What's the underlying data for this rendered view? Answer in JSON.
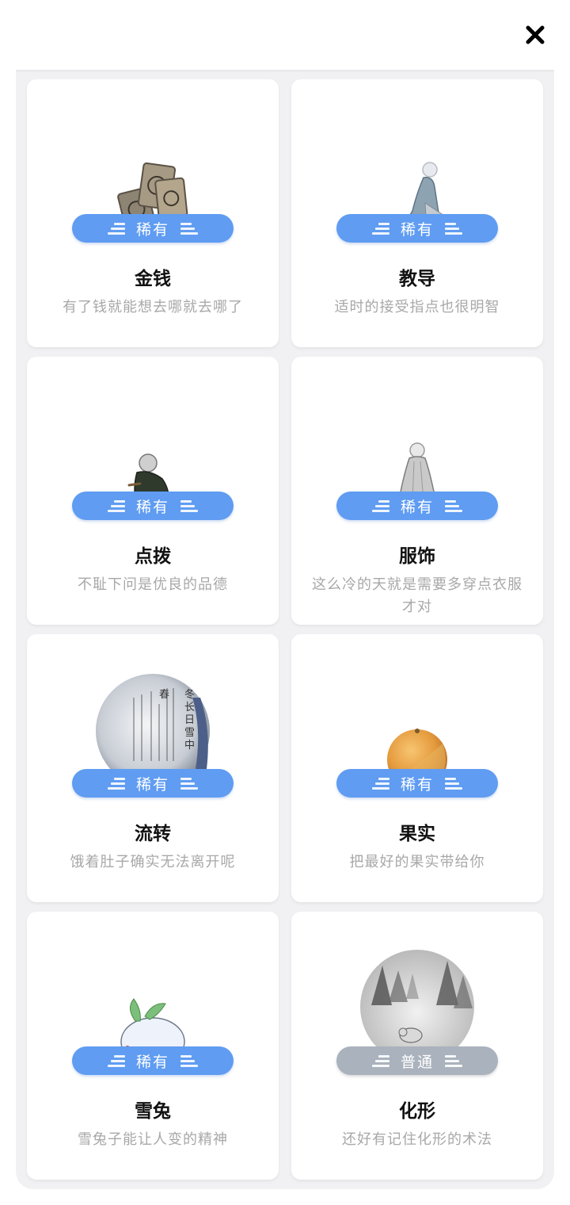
{
  "header": {
    "close_icon": "close-icon"
  },
  "items": [
    {
      "name": "金钱",
      "rarity": "稀有",
      "desc": "有了钱就能想去哪就去哪了",
      "icon": "coins-illustration"
    },
    {
      "name": "教导",
      "rarity": "稀有",
      "desc": "适时的接受指点也很明智",
      "icon": "kneeling-figure-illustration"
    },
    {
      "name": "点拨",
      "rarity": "稀有",
      "desc": "不耻下问是优良的品德",
      "icon": "sitting-elder-illustration"
    },
    {
      "name": "服饰",
      "rarity": "稀有",
      "desc": "这么冷的天就是需要多穿点衣服才对",
      "icon": "robed-figure-illustration"
    },
    {
      "name": "流转",
      "rarity": "稀有",
      "desc": "饿着肚子确实无法离开呢",
      "icon": "poem-scroll-illustration"
    },
    {
      "name": "果实",
      "rarity": "稀有",
      "desc": "把最好的果实带给你",
      "icon": "orange-fruit-illustration"
    },
    {
      "name": "雪兔",
      "rarity": "稀有",
      "desc": "雪兔子能让人变的精神",
      "icon": "snow-rabbit-illustration"
    },
    {
      "name": "化形",
      "rarity": "普通",
      "desc": "还好有记住化形的术法",
      "icon": "snowy-forest-fox-illustration"
    }
  ],
  "colors": {
    "rare": "#5f9cf2",
    "common": "#aab2bd",
    "panel": "#f1f1f3"
  },
  "poem_text": [
    "冬",
    "长",
    "日",
    "雪",
    "中",
    "春"
  ]
}
